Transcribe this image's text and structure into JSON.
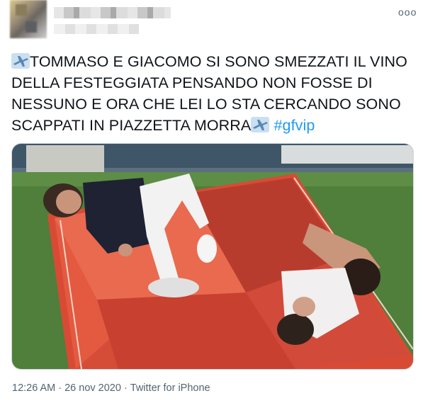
{
  "tweet": {
    "text_line_1": "TOMMASO E GIACOMO SI SONO SMEZZATI IL VINO",
    "text_line_2": "DELLA FESTEGGIATA PENSANDO NON FOSSE DI",
    "text_line_3": "NESSUNO E ORA CHE LEI LO STA CERCANDO SONO",
    "text_line_4": "SCAPPATI IN PIAZZETTA MORRA",
    "hashtag": "#gfvip",
    "icon_emoji": "airplane-icon",
    "media_icon": "photo",
    "more_icon_glyph": "ooo"
  },
  "meta": {
    "time": "12:26 AM",
    "date": "26 nov 2020",
    "source": "Twitter for iPhone",
    "separator": "·"
  },
  "colors": {
    "text": "#0f1419",
    "hashtag": "#1d9bf0",
    "meta": "#536471",
    "border": "#cfd9de"
  }
}
